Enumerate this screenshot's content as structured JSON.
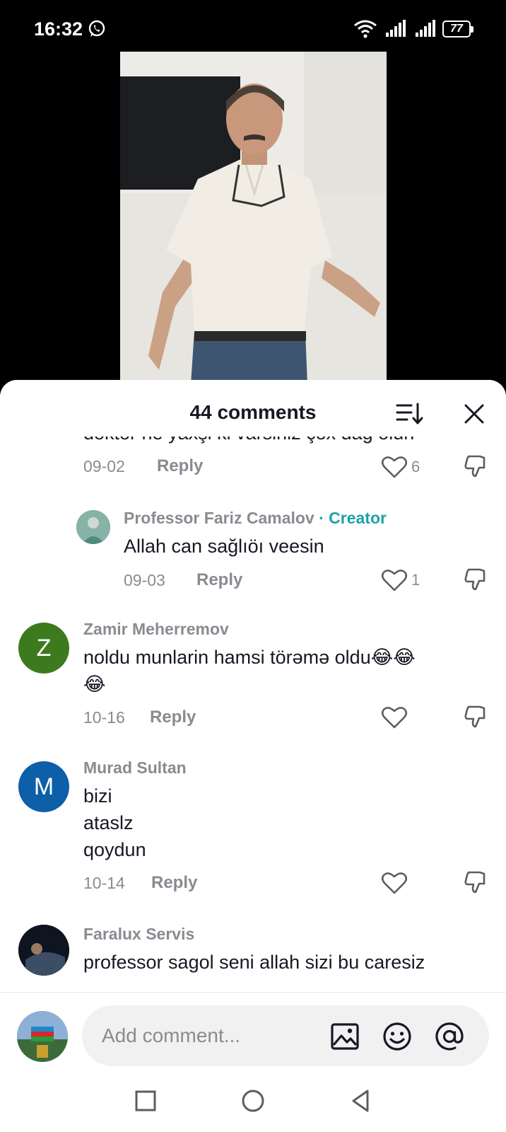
{
  "status_bar": {
    "time": "16:32",
    "battery": "77"
  },
  "sheet": {
    "title": "44 comments"
  },
  "comments": [
    {
      "text": "doktor ne yaxşi ki varsiniz çox dag olun",
      "date": "09-02",
      "reply_label": "Reply",
      "likes": "6"
    },
    {
      "username": "Professor Fariz Camalov",
      "badge": "· Creator",
      "text": "Allah can sağlıöı veesin",
      "date": "09-03",
      "reply_label": "Reply",
      "likes": "1"
    },
    {
      "username": "Zamir Meherremov",
      "avatar_letter": "Z",
      "avatar_color": "#3d7a1e",
      "text_line1": "noldu munlarin hamsi törəmə oldu😂😂",
      "text_line2": "😂",
      "date": "10-16",
      "reply_label": "Reply"
    },
    {
      "username": "Murad Sultan",
      "avatar_letter": "M",
      "avatar_color": "#0c5fa8",
      "text_line1": "bizi",
      "text_line2": "ataslz",
      "text_line3": "qoydun",
      "date": "10-14",
      "reply_label": "Reply"
    },
    {
      "username": "Faralux Servis",
      "text": "professor sagol seni allah sizi bu caresiz"
    }
  ],
  "input": {
    "placeholder": "Add comment..."
  },
  "icons": [
    "whatsapp-icon",
    "wifi-icon",
    "signal-icon",
    "battery-icon",
    "sort-icon",
    "close-icon",
    "heart-icon",
    "dislike-icon",
    "image-icon",
    "emoji-icon",
    "at-icon",
    "nav-recents-icon",
    "nav-home-icon",
    "nav-back-icon"
  ]
}
